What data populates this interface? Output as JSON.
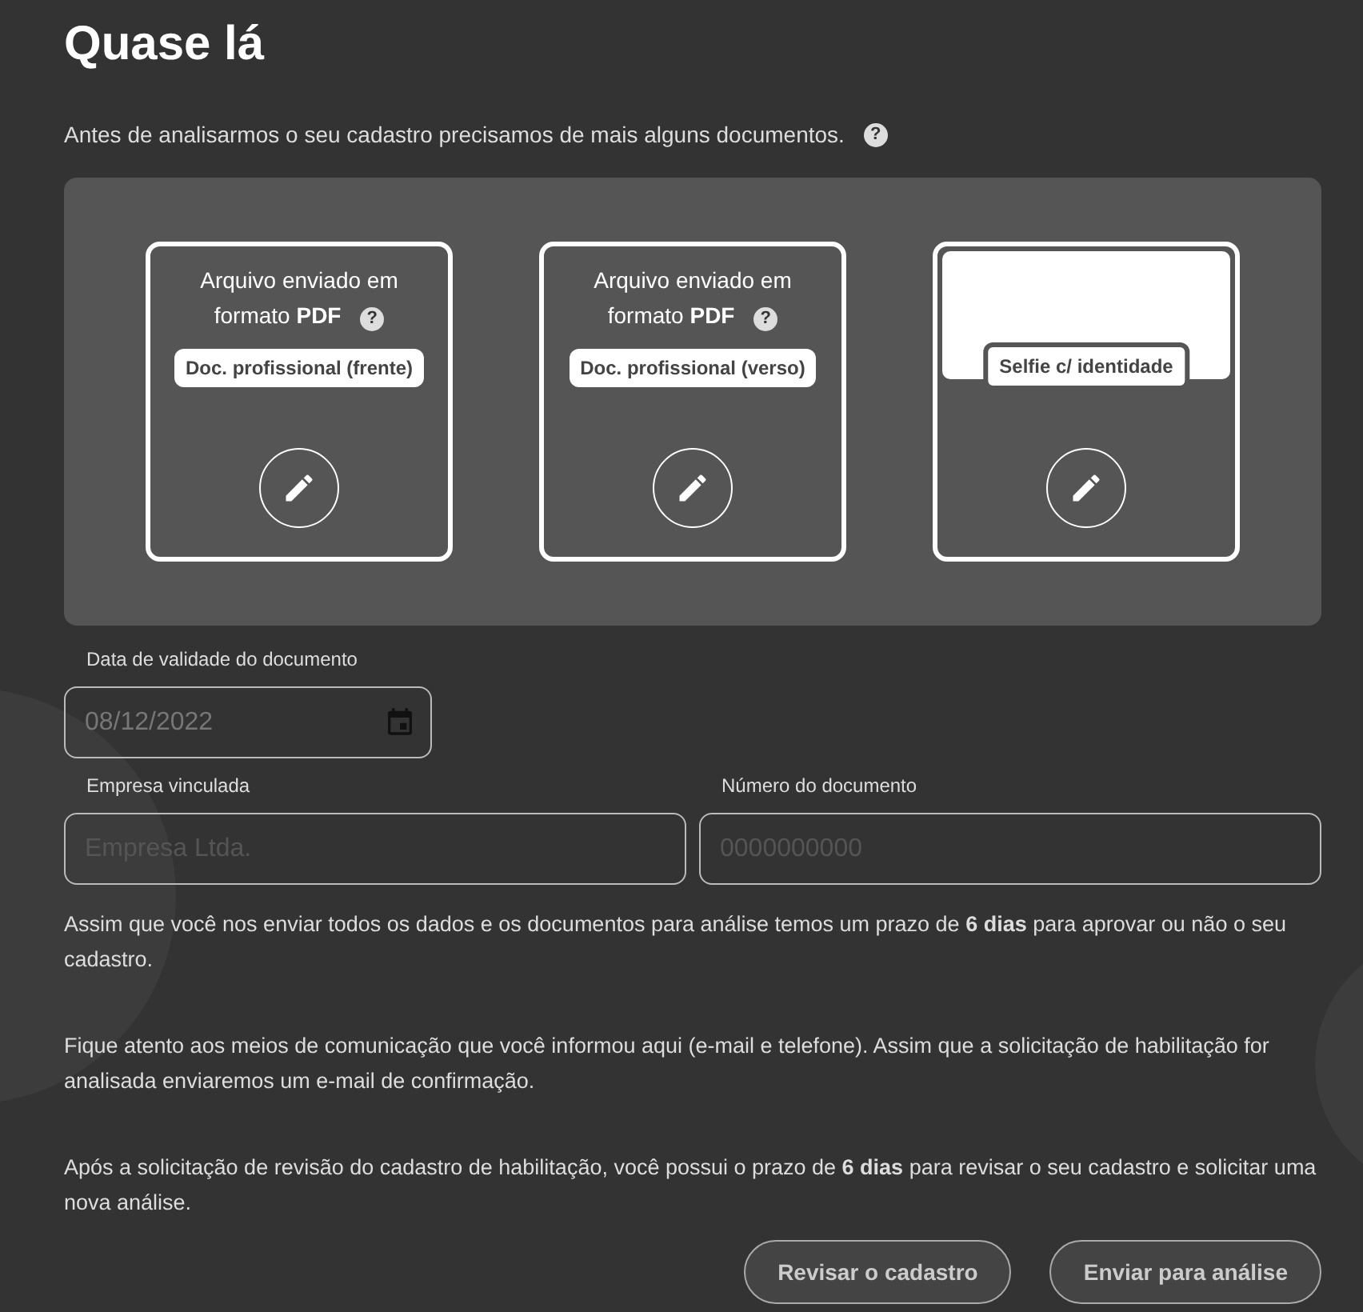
{
  "title": "Quase lá",
  "intro": {
    "text": "Antes de analisarmos o seu cadastro precisamos de mais alguns documentos.",
    "help": "?"
  },
  "documents": [
    {
      "kind": "pdf",
      "status": "Arquivo enviado em formato **PDF**",
      "help": "?",
      "label": "Doc. profissional (frente)"
    },
    {
      "kind": "pdf",
      "status": "Arquivo enviado em formato **PDF**",
      "help": "?",
      "label": "Doc. profissional (verso)"
    },
    {
      "kind": "photo",
      "label": "Selfie c/ identidade"
    }
  ],
  "validity": {
    "label": "Data de validade do documento",
    "value": "08/12/2022",
    "disabled": true
  },
  "company": {
    "label": "Empresa vinculada",
    "placeholder": "Empresa Ltda."
  },
  "doc_number": {
    "label": "Número do documento",
    "placeholder": "0000000000"
  },
  "paragraphs": [
    "Assim que você nos enviar todos os dados e os documentos para análise temos um prazo de **6 dias** para aprovar ou não o seu cadastro.",
    "Fique atento aos meios de comunicação que você informou aqui (e-mail e telefone). Assim que a solicitação de habilitação for analisada enviaremos um e-mail de confirmação.",
    "Após a solicitação de revisão do cadastro de habilitação, você possui o prazo de **6 dias** para revisar o seu cadastro e solicitar uma nova análise."
  ],
  "buttons": [
    "Revisar o cadastro",
    "Enviar para análise"
  ]
}
